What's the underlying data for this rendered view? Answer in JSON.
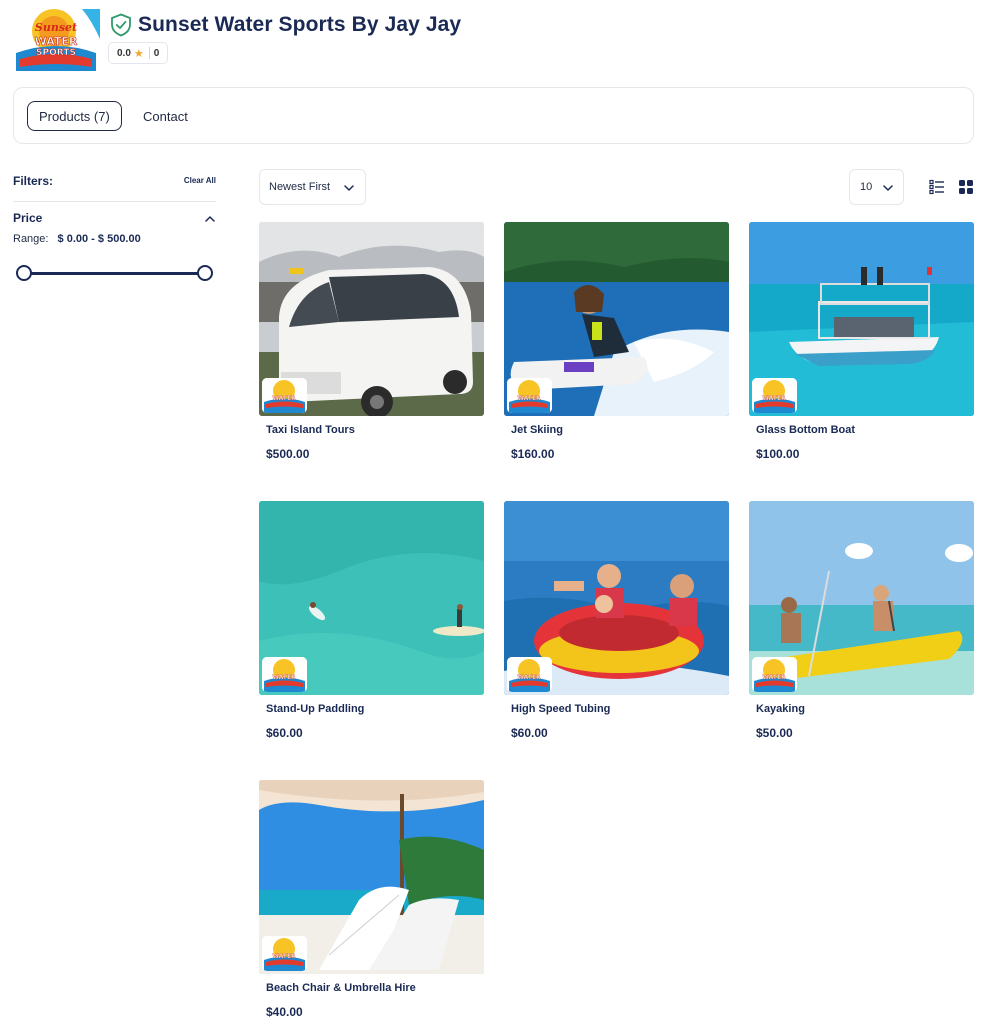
{
  "store": {
    "name": "Sunset Water Sports By Jay Jay",
    "rating": "0.0",
    "review_count": "0",
    "logo_text_line1": "Sunset",
    "logo_text_line2": "WATER",
    "logo_text_line3": "SPORTS"
  },
  "tabs": {
    "products_label": "Products (7)",
    "contact_label": "Contact"
  },
  "filters": {
    "title": "Filters:",
    "clear_all": "Clear All",
    "price_title": "Price",
    "range_label": "Range:",
    "range_value": "$ 0.00 - $ 500.00"
  },
  "toolbar": {
    "sort_value": "Newest First",
    "per_page_value": "10"
  },
  "products": [
    {
      "name": "Taxi Island Tours",
      "price": "$500.00"
    },
    {
      "name": "Jet Skiing",
      "price": "$160.00"
    },
    {
      "name": "Glass Bottom Boat",
      "price": "$100.00"
    },
    {
      "name": "Stand-Up Paddling",
      "price": "$60.00"
    },
    {
      "name": "High Speed Tubing",
      "price": "$60.00"
    },
    {
      "name": "Kayaking",
      "price": "$50.00"
    },
    {
      "name": "Beach Chair & Umbrella Hire",
      "price": "$40.00"
    }
  ],
  "colors": {
    "primary": "#1a2a55",
    "star": "#f0a630",
    "verified": "#2e9a6b",
    "border": "#e4e7ec"
  }
}
